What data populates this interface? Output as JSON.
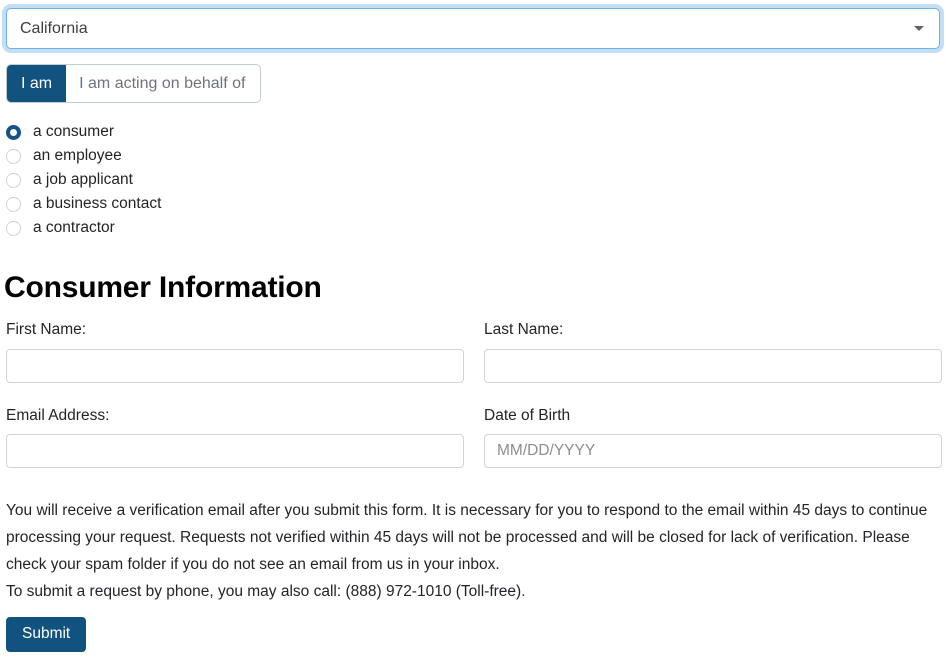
{
  "state_select": {
    "name": "state-select",
    "value": "California",
    "icon": "chevron-down-icon"
  },
  "tabs": [
    {
      "label": "I am",
      "active": true
    },
    {
      "label": "I am acting on behalf of",
      "active": false
    }
  ],
  "requester_type": {
    "options": [
      {
        "label": "a consumer",
        "checked": true
      },
      {
        "label": "an employee",
        "checked": false
      },
      {
        "label": "a job applicant",
        "checked": false
      },
      {
        "label": "a business contact",
        "checked": false
      },
      {
        "label": "a contractor",
        "checked": false
      }
    ]
  },
  "section": {
    "title": "Consumer Information"
  },
  "fields": {
    "first_name": {
      "label": "First Name:",
      "value": "",
      "placeholder": ""
    },
    "last_name": {
      "label": "Last Name:",
      "value": "",
      "placeholder": ""
    },
    "email": {
      "label": "Email Address:",
      "value": "",
      "placeholder": ""
    },
    "dob": {
      "label": "Date of Birth",
      "value": "",
      "placeholder": "MM/DD/YYYY"
    }
  },
  "notice": {
    "paragraph": "You will receive a verification email after you submit this form. It is necessary for you to respond to the email within 45 days to continue processing your request. Requests not verified within 45 days will not be processed and will be closed for lack of verification. Please check your spam folder if you do not see an email from us in your inbox.",
    "phone_line": "To submit a request by phone, you may also call: (888) 972-1010 (Toll-free)."
  },
  "submit": {
    "label": "Submit"
  },
  "colors": {
    "brand_navy": "#12527e",
    "focus_blue": "#72b0e0",
    "input_border": "#ced4da",
    "muted_text": "#6c757d"
  }
}
